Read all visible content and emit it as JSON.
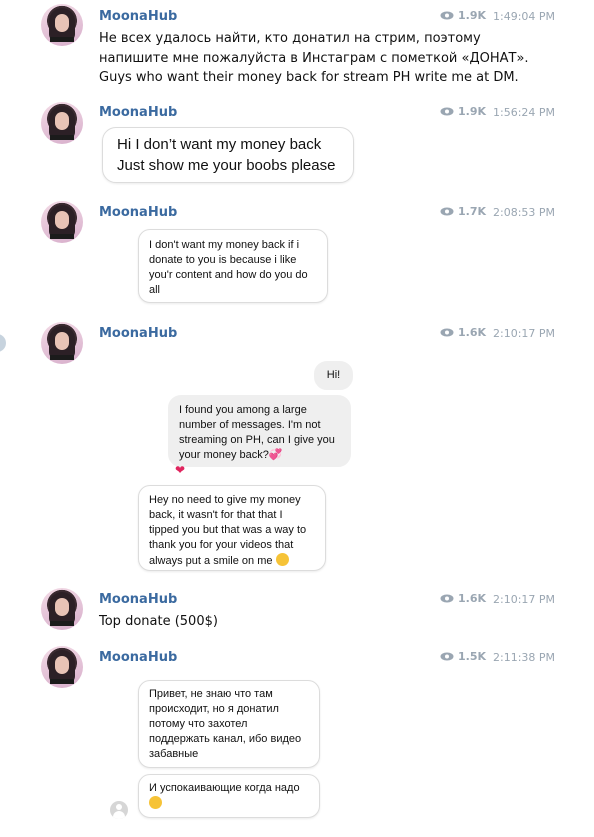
{
  "colors": {
    "sender": "#3b6aa0",
    "meta": "#9aa6b2",
    "bubble_grey": "#efefef",
    "heart": "#e0245e"
  },
  "messages": [
    {
      "sender": "MoonaHub",
      "views": "1.9K",
      "time": "1:49:04 PM",
      "lines": [
        "Не всех удалось найти, кто донатил на стрим, поэтому",
        "напишите мне пожалуйста в Инстаграм с пометкой «ДОНАТ».",
        "Guys who want their money back for stream PH write me at DM."
      ]
    },
    {
      "sender": "MoonaHub",
      "views": "1.9K",
      "time": "1:56:24 PM",
      "image_lines": [
        "Hi I don’t want my money back",
        "Just show me your boobs please"
      ]
    },
    {
      "sender": "MoonaHub",
      "views": "1.7K",
      "time": "2:08:53 PM",
      "image_lines": [
        "I don't want my money back if i",
        "donate to you is because i like",
        "you'r content and how do you do",
        "all"
      ]
    },
    {
      "sender": "MoonaHub",
      "views": "1.6K",
      "time": "2:10:17 PM",
      "image_hi": "Hi!",
      "image_grey_lines": [
        "I found you among a large",
        "number of messages. I'm not",
        "streaming on PH, can I give you",
        "your money back?"
      ],
      "image_reply_lines": [
        "Hey no need to give my money",
        "back, it wasn't for that that I",
        "tipped you but that was a way to",
        "thank you for your videos that",
        "always put a smile on me"
      ]
    },
    {
      "sender": "MoonaHub",
      "views": "1.6K",
      "time": "2:10:17 PM",
      "text": "Top donate (500$)"
    },
    {
      "sender": "MoonaHub",
      "views": "1.5K",
      "time": "2:11:38 PM",
      "image_lines": [
        "Привет, не знаю что там",
        "происходит, но я донатил",
        "потому что захотел",
        "поддержать канал, ибо видео",
        "забавные"
      ],
      "image_lines2": [
        "И успокаивающие когда надо"
      ]
    }
  ]
}
